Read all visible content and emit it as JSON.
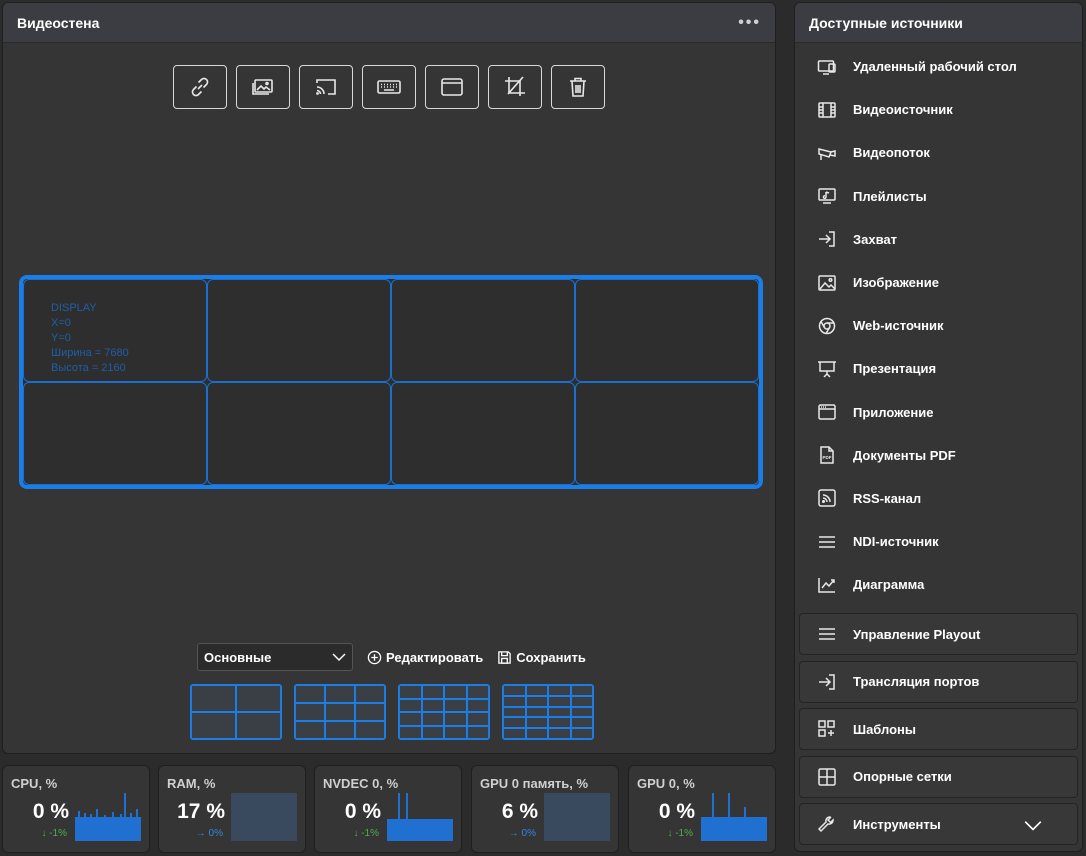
{
  "video_wall": {
    "title": "Видеостена",
    "menu_icon": "more-dots-icon",
    "toolbar": [
      "link-icon",
      "images-icon",
      "cast-icon",
      "keyboard-icon",
      "window-icon",
      "crop-icon",
      "trash-icon"
    ],
    "display": {
      "name": "DISPLAY",
      "x": "X=0",
      "y": "Y=0",
      "width": "Ширина = 7680",
      "height": "Высота = 2160"
    },
    "layout_select": "Основные",
    "edit_label": "Редактировать",
    "save_label": "Сохранить",
    "accent_color": "#1a7ee6"
  },
  "sources": {
    "title": "Доступные источники",
    "items": [
      {
        "label": "Удаленный рабочий стол",
        "icon": "remote-desktop-icon"
      },
      {
        "label": "Видеоисточник",
        "icon": "film-icon"
      },
      {
        "label": "Видеопоток",
        "icon": "camera-icon"
      },
      {
        "label": "Плейлисты",
        "icon": "playlist-icon"
      },
      {
        "label": "Захват",
        "icon": "sign-in-icon"
      },
      {
        "label": "Изображение",
        "icon": "image-icon"
      },
      {
        "label": "Web-источник",
        "icon": "chrome-icon"
      },
      {
        "label": "Презентация",
        "icon": "presentation-icon"
      },
      {
        "label": "Приложение",
        "icon": "app-window-icon"
      },
      {
        "label": "Документы PDF",
        "icon": "pdf-icon"
      },
      {
        "label": "RSS-канал",
        "icon": "rss-icon"
      },
      {
        "label": "NDI-источник",
        "icon": "lines-icon"
      },
      {
        "label": "Диаграмма",
        "icon": "chart-line-icon"
      }
    ],
    "boxes": [
      {
        "label": "Управление Playout",
        "icon": "lines-icon"
      },
      {
        "label": "Трансляция портов",
        "icon": "sign-in-icon"
      },
      {
        "label": "Шаблоны",
        "icon": "templates-icon"
      },
      {
        "label": "Опорные сетки",
        "icon": "grid-icon"
      },
      {
        "label": "Инструменты",
        "icon": "wrench-icon"
      }
    ]
  },
  "metrics": [
    {
      "title": "CPU, %",
      "value": "0 %",
      "delta": "↓ -1%",
      "delta_color": "#4caf50"
    },
    {
      "title": "RAM, %",
      "value": "17 %",
      "delta": "→ 0%",
      "delta_color": "#2f86e8"
    },
    {
      "title": "NVDEC 0, %",
      "value": "0 %",
      "delta": "↓ -1%",
      "delta_color": "#4caf50"
    },
    {
      "title": "GPU 0 память, %",
      "value": "6 %",
      "delta": "→ 0%",
      "delta_color": "#2f86e8"
    },
    {
      "title": "GPU 0, %",
      "value": "0 %",
      "delta": "↓ -1%",
      "delta_color": "#4caf50"
    }
  ]
}
